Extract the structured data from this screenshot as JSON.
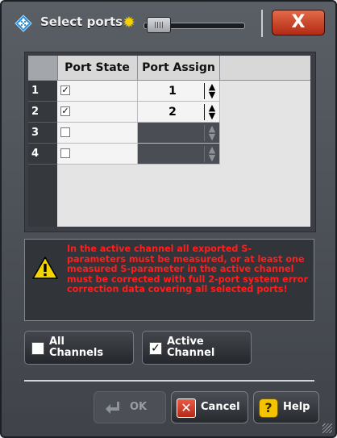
{
  "window": {
    "title": "Select ports",
    "close_label": "X"
  },
  "grid": {
    "columns": [
      "Port State",
      "Port Assign"
    ],
    "rows": [
      {
        "num": "1",
        "checked": true,
        "check_mark": "✓",
        "assign": "1",
        "enabled": true
      },
      {
        "num": "2",
        "checked": true,
        "check_mark": "✓",
        "assign": "2",
        "enabled": true
      },
      {
        "num": "3",
        "checked": false,
        "check_mark": "",
        "assign": "",
        "enabled": false
      },
      {
        "num": "4",
        "checked": false,
        "check_mark": "",
        "assign": "",
        "enabled": false
      }
    ]
  },
  "warning": {
    "text": "In the active channel all exported S-parameters must be measured, or at least one measured S-parameter in the active channel must be corrected with full 2-port system error correction data covering all selected ports!",
    "color": "#ff1e1e"
  },
  "options": {
    "all_channels": {
      "line1": "All",
      "line2": "Channels",
      "checked": false,
      "check_mark": ""
    },
    "active_channel": {
      "line1": "Active",
      "line2": "Channel",
      "checked": true,
      "check_mark": "✓"
    }
  },
  "buttons": {
    "ok": {
      "label": "OK",
      "enabled": false
    },
    "cancel": {
      "label": "Cancel"
    },
    "help": {
      "label": "Help"
    }
  },
  "icons": {
    "title": "diamond-arrows-icon",
    "brightness": "sun-icon",
    "warning": "warning-triangle-icon",
    "ok": "enter-arrow-icon",
    "cancel": "red-x-icon",
    "help": "question-bubble-icon"
  }
}
